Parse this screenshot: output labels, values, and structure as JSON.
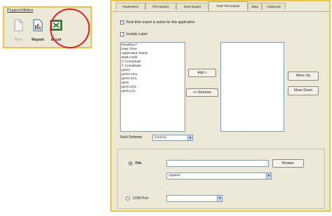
{
  "snippet": {
    "title": "Plugins/Utilities",
    "toolbar": [
      {
        "label": "New",
        "icon": "new-document-icon"
      },
      {
        "label": "Report",
        "icon": "report-icon"
      },
      {
        "label": "Excel",
        "icon": "excel-icon"
      }
    ]
  },
  "dialog": {
    "tabs": [
      "Parameters",
      "Plot Options",
      "Excel Export",
      "Real Time Export",
      "Stats",
      "Advanced"
    ],
    "active_tab": "Real Time Export",
    "realtime_checkbox": {
      "label": "Real time export is active for this application",
      "checked": true
    },
    "include_label_checkbox": {
      "label": "Include Label",
      "checked": false
    },
    "available_fields": [
      "Reading #",
      "Date Time",
      "Application Name",
      "Mark Field",
      "X Coordinate",
      "Y Coordinate",
      "gm/m",
      "gm/m-UCL",
      "gm/m-LCL",
      "gm/s",
      "gm/s-UCL",
      "gm/s-LCL"
    ],
    "selected_fields": [],
    "buttons": {
      "add": "Add >",
      "remove": "<< Remove",
      "move_up": "Move Up",
      "move_down": "Move Down",
      "browse": "Browse"
    },
    "field_delimiter": {
      "label": "Field Delimiter",
      "value": "Comma"
    },
    "output": {
      "file_radio": {
        "label": "File",
        "selected": true
      },
      "file_path": "",
      "file_mode": "Append",
      "com_radio": {
        "label": "COM Port",
        "selected": false
      },
      "com_port": ""
    },
    "colors": {
      "highlight_border": "#e8c64c",
      "callout_circle": "#e02020"
    }
  }
}
